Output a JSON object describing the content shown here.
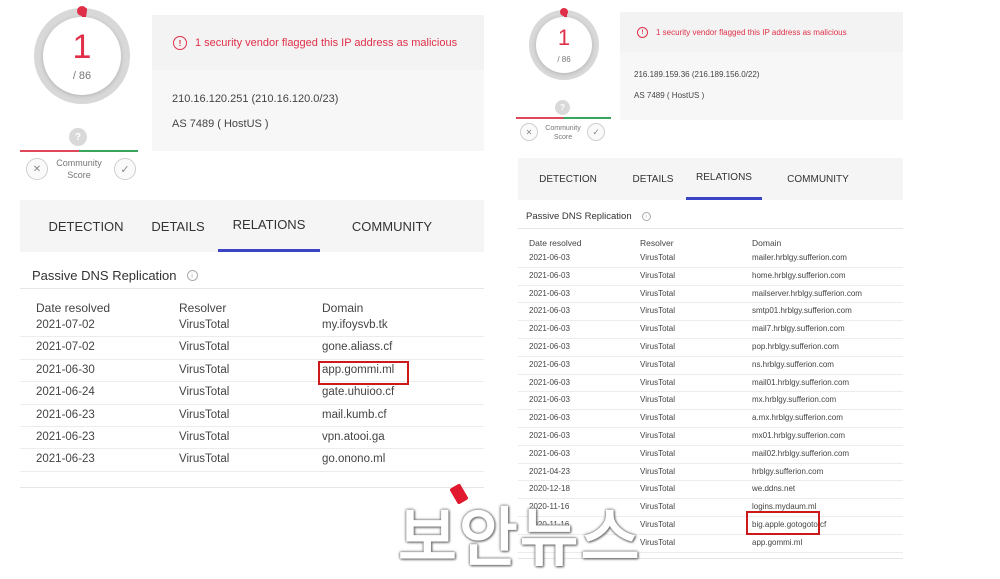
{
  "left": {
    "detection": {
      "score": "1",
      "total": "/ 86"
    },
    "community_score": {
      "unknown": "?",
      "label_line1": "Community",
      "label_line2": "Score",
      "down_icon": "x-icon",
      "up_icon": "check-icon"
    },
    "alert": "1 security vendor flagged this IP address as malicious",
    "ip": "210.16.120.251  (210.16.120.0/23)",
    "as": "AS 7489 ( HostUS )",
    "tabs": [
      "DETECTION",
      "DETAILS",
      "RELATIONS",
      "COMMUNITY"
    ],
    "active_tab": "RELATIONS",
    "section_title": "Passive DNS Replication",
    "headers": [
      "Date resolved",
      "Resolver",
      "Domain"
    ],
    "rows": [
      [
        "2021-07-02",
        "VirusTotal",
        "my.ifoysvb.tk"
      ],
      [
        "2021-07-02",
        "VirusTotal",
        "gone.aliass.cf"
      ],
      [
        "2021-06-30",
        "VirusTotal",
        "app.gommi.ml"
      ],
      [
        "2021-06-24",
        "VirusTotal",
        "gate.uhuioo.cf"
      ],
      [
        "2021-06-23",
        "VirusTotal",
        "mail.kumb.cf"
      ],
      [
        "2021-06-23",
        "VirusTotal",
        "vpn.atooi.ga"
      ],
      [
        "2021-06-23",
        "VirusTotal",
        "go.onono.ml"
      ]
    ],
    "highlighted_domain": "app.gommi.ml"
  },
  "right": {
    "detection": {
      "score": "1",
      "total": "/ 86"
    },
    "community_score": {
      "unknown": "?",
      "label_line1": "Community",
      "label_line2": "Score",
      "down_icon": "x-icon",
      "up_icon": "check-icon"
    },
    "alert": "1 security vendor flagged this IP address as malicious",
    "ip": "216.189.159.36  (216.189.156.0/22)",
    "as": "AS 7489 ( HostUS )",
    "tabs": [
      "DETECTION",
      "DETAILS",
      "RELATIONS",
      "COMMUNITY"
    ],
    "active_tab": "RELATIONS",
    "section_title": "Passive DNS Replication",
    "headers": [
      "Date resolved",
      "Resolver",
      "Domain"
    ],
    "rows": [
      [
        "2021-06-03",
        "VirusTotal",
        "mailer.hrblgy.sufferion.com"
      ],
      [
        "2021-06-03",
        "VirusTotal",
        "home.hrblgy.sufferion.com"
      ],
      [
        "2021-06-03",
        "VirusTotal",
        "mailserver.hrblgy.sufferion.com"
      ],
      [
        "2021-06-03",
        "VirusTotal",
        "smtp01.hrblgy.sufferion.com"
      ],
      [
        "2021-06-03",
        "VirusTotal",
        "mail7.hrblgy.sufferion.com"
      ],
      [
        "2021-06-03",
        "VirusTotal",
        "pop.hrblgy.sufferion.com"
      ],
      [
        "2021-06-03",
        "VirusTotal",
        "ns.hrblgy.sufferion.com"
      ],
      [
        "2021-06-03",
        "VirusTotal",
        "mail01.hrblgy.sufferion.com"
      ],
      [
        "2021-06-03",
        "VirusTotal",
        "mx.hrblgy.sufferion.com"
      ],
      [
        "2021-06-03",
        "VirusTotal",
        "a.mx.hrblgy.sufferion.com"
      ],
      [
        "2021-06-03",
        "VirusTotal",
        "mx01.hrblgy.sufferion.com"
      ],
      [
        "2021-06-03",
        "VirusTotal",
        "mail02.hrblgy.sufferion.com"
      ],
      [
        "2021-04-23",
        "VirusTotal",
        "hrblgy.sufferion.com"
      ],
      [
        "2020-12-18",
        "VirusTotal",
        "we.ddns.net"
      ],
      [
        "2020-11-16",
        "VirusTotal",
        "logins.mydaum.ml"
      ],
      [
        "2020-11-16",
        "VirusTotal",
        "big.apple.gotogoto.cf"
      ],
      [
        "2020-11-16",
        "VirusTotal",
        "app.gommi.ml"
      ]
    ],
    "highlighted_domain": "app.gommi.ml"
  },
  "watermark": "보안뉴스",
  "colors": {
    "malicious": "#e03049",
    "active_tab": "#3b44c4",
    "highlight_box": "#cc1a1a"
  }
}
